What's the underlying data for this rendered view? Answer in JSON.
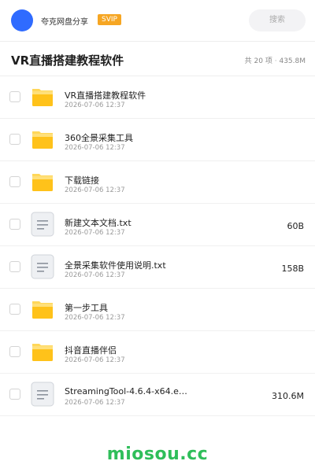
{
  "header": {
    "brand": "夸克网盘分享",
    "badge": "SVIP",
    "search_label": "搜索"
  },
  "folder": {
    "title": "VR直播搭建教程软件",
    "count": "共 20 项",
    "separator": "·",
    "size": "435.8M"
  },
  "items": [
    {
      "type": "folder",
      "name": "VR直播搭建教程软件",
      "date": "2026-07-06 12:37",
      "size": ""
    },
    {
      "type": "folder",
      "name": "360全景采集工具",
      "date": "2026-07-06 12:37",
      "size": ""
    },
    {
      "type": "folder",
      "name": "下载链接",
      "date": "2026-07-06 12:37",
      "size": ""
    },
    {
      "type": "file",
      "name": "新建文本文档.txt",
      "date": "2026-07-06 12:37",
      "size": "60B"
    },
    {
      "type": "file",
      "name": "全景采集软件使用说明.txt",
      "date": "2026-07-06 12:37",
      "size": "158B"
    },
    {
      "type": "folder",
      "name": "第一步工具",
      "date": "2026-07-06 12:37",
      "size": ""
    },
    {
      "type": "folder",
      "name": "抖音直播伴侣",
      "date": "2026-07-06 12:37",
      "size": ""
    },
    {
      "type": "file",
      "name": "StreamingTool-4.6.4-x64.e…",
      "date": "2026-07-06 12:37",
      "size": "310.6M"
    }
  ],
  "icons": {
    "folder": "folder-icon",
    "file": "text-file-icon"
  },
  "colors": {
    "avatar": "#2f6bff",
    "badge": "#f6a623",
    "folder": "#ffc21a",
    "watermark": "#2fbe5a"
  },
  "watermark": "miosou.cc"
}
